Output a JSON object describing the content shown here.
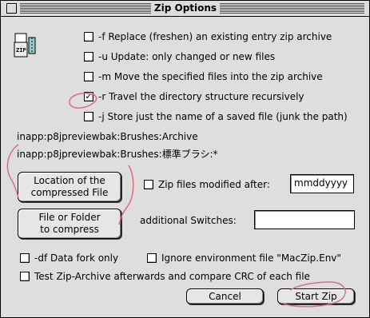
{
  "window": {
    "title": "Zip Options"
  },
  "options": [
    {
      "label": "-f Replace (freshen) an existing entry zip archive",
      "checked": false
    },
    {
      "label": "-u Update: only changed or new files",
      "checked": false
    },
    {
      "label": "-m Move the specified files into the zip archive",
      "checked": false
    },
    {
      "label": "-r Travel the directory structure recursively",
      "checked": true
    },
    {
      "label": "-j Store just the name of a saved file (junk the path)",
      "checked": false
    }
  ],
  "paths": {
    "archive": "inapp:p8jpreviewbak:Brushes:Archive",
    "source": "inapp:p8jpreviewbak:Brushes:標準ブラシ:*"
  },
  "buttons": {
    "location": "Location of the\ncompressed File",
    "file_or_folder": "File or Folder\nto compress",
    "cancel": "Cancel",
    "start": "Start Zip"
  },
  "date_filter": {
    "label": "Zip files modified after:",
    "value": "mmddyyyy",
    "checked": false
  },
  "switches": {
    "label": "additional Switches:",
    "value": ""
  },
  "bottom_options": {
    "data_fork": {
      "label": "-df Data fork only",
      "checked": false
    },
    "ignore_env": {
      "label": "Ignore environment file \"MacZip.Env\"",
      "checked": false
    },
    "test_archive": {
      "label": "Test Zip-Archive afterwards and compare CRC of each file",
      "checked": false
    }
  },
  "logo": {
    "text": "ZIP"
  },
  "colors": {
    "annotation": "#d9707e",
    "face": "#dedede"
  }
}
